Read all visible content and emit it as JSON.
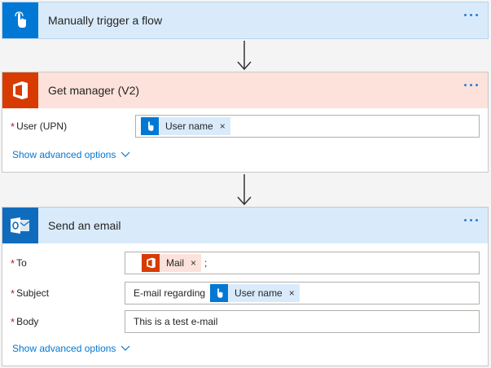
{
  "trigger": {
    "title": "Manually trigger a flow",
    "color": "#0078d4",
    "icon": "touch-icon"
  },
  "manager": {
    "title": "Get manager (V2)",
    "color": "#d83b01",
    "fields": {
      "user_label": "User (UPN)",
      "user_token": "User name"
    },
    "advanced": "Show advanced options"
  },
  "email": {
    "title": "Send an email",
    "color": "#0f6cbd",
    "to_label": "To",
    "to_token": "Mail",
    "to_sep": ";",
    "subject_label": "Subject",
    "subject_text": "E-mail regarding",
    "subject_token": "User name",
    "body_label": "Body",
    "body_text": "This is a test e-mail",
    "advanced": "Show advanced options"
  },
  "common": {
    "required_mark": "*",
    "remove_mark": "×"
  }
}
